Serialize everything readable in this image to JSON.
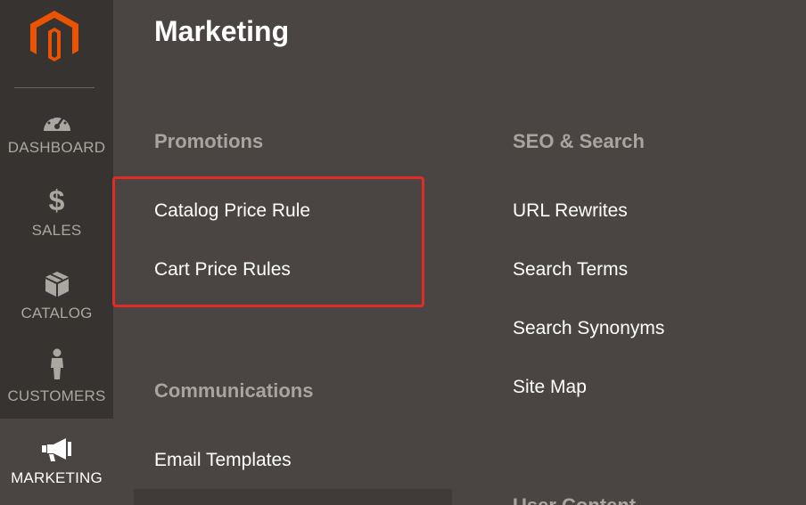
{
  "sidebar": {
    "logo_icon": "magento-logo-icon",
    "items": [
      {
        "label": "DASHBOARD",
        "icon": "dashboard-gauge-icon",
        "active": false
      },
      {
        "label": "SALES",
        "icon": "dollar-icon",
        "active": false
      },
      {
        "label": "CATALOG",
        "icon": "box-icon",
        "active": false
      },
      {
        "label": "CUSTOMERS",
        "icon": "person-icon",
        "active": false
      },
      {
        "label": "MARKETING",
        "icon": "megaphone-icon",
        "active": true
      }
    ]
  },
  "panel": {
    "title": "Marketing",
    "sections": [
      {
        "title": "Promotions",
        "links": [
          "Catalog Price Rule",
          "Cart Price Rules"
        ]
      },
      {
        "title": "Communications",
        "links": [
          "Email Templates"
        ]
      },
      {
        "title": "SEO & Search",
        "links": [
          "URL Rewrites",
          "Search Terms",
          "Search Synonyms",
          "Site Map"
        ]
      },
      {
        "title": "User Content",
        "links": []
      }
    ]
  },
  "colors": {
    "sidebar_bg": "#373330",
    "panel_bg": "#4a4542",
    "logo_orange": "#eb5202",
    "highlight_red": "#e02b27",
    "section_title": "#a9a49f"
  }
}
